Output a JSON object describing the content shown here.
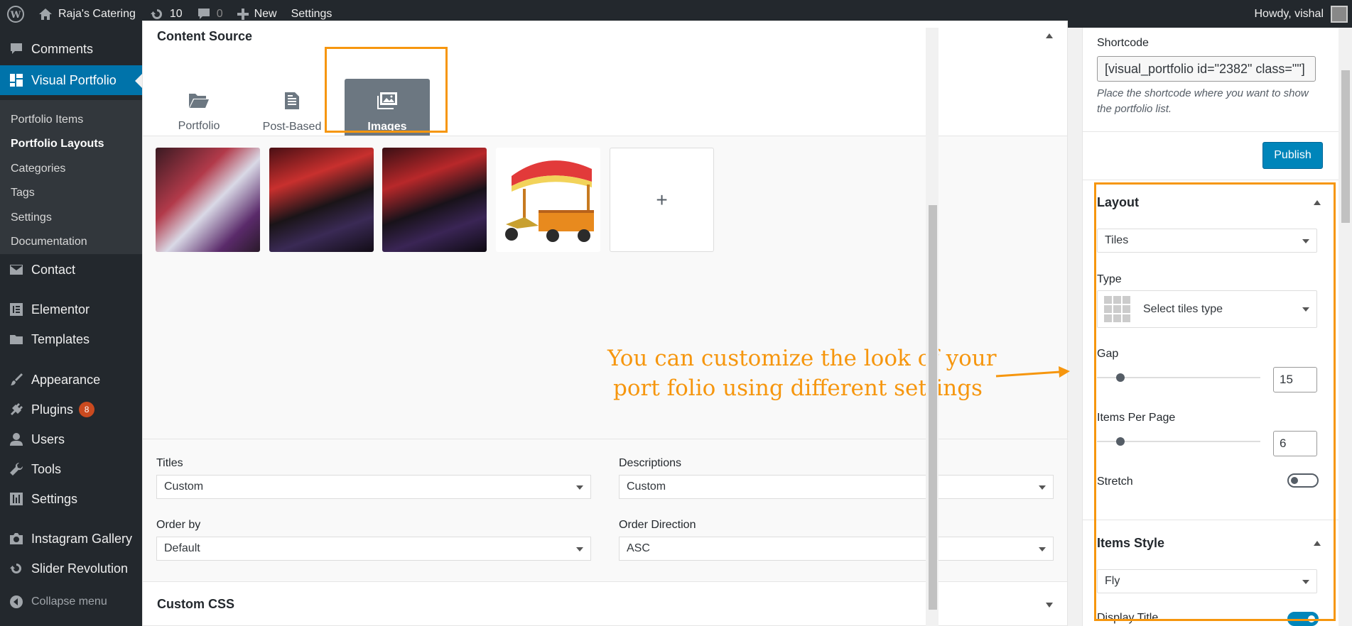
{
  "adminbar": {
    "site_name": "Raja's Catering",
    "updates_count": "10",
    "comments_count": "0",
    "new_label": "New",
    "settings_label": "Settings",
    "howdy": "Howdy, vishal"
  },
  "sidebar": {
    "comments": "Comments",
    "visual_portfolio": "Visual Portfolio",
    "sub": {
      "portfolio_items": "Portfolio Items",
      "portfolio_layouts": "Portfolio Layouts",
      "categories": "Categories",
      "tags": "Tags",
      "settings": "Settings",
      "documentation": "Documentation"
    },
    "contact": "Contact",
    "elementor": "Elementor",
    "templates": "Templates",
    "appearance": "Appearance",
    "plugins": "Plugins",
    "plugins_badge": "8",
    "users": "Users",
    "tools": "Tools",
    "settings": "Settings",
    "instagram": "Instagram Gallery",
    "slider": "Slider Revolution",
    "collapse": "Collapse menu"
  },
  "content": {
    "section_title": "Content Source",
    "tabs": {
      "portfolio": "Portfolio",
      "post_based": "Post-Based",
      "images": "Images"
    },
    "add_symbol": "+",
    "titles_label": "Titles",
    "titles_value": "Custom",
    "descriptions_label": "Descriptions",
    "descriptions_value": "Custom",
    "orderby_label": "Order by",
    "orderby_value": "Default",
    "orderdir_label": "Order Direction",
    "orderdir_value": "ASC",
    "custom_css": "Custom CSS"
  },
  "annotation": {
    "line1": "You can customize the look of your",
    "line2": "port folio using different settings"
  },
  "right": {
    "shortcode_label": "Shortcode",
    "shortcode_value": "[visual_portfolio id=\"2382\" class=\"\"]",
    "shortcode_help": "Place the shortcode where you want to show the portfolio list.",
    "publish": "Publish",
    "layout_title": "Layout",
    "layout_value": "Tiles",
    "type_label": "Type",
    "type_value": "Select tiles type",
    "gap_label": "Gap",
    "gap_value": "15",
    "items_per_page_label": "Items Per Page",
    "items_per_page_value": "6",
    "stretch_label": "Stretch",
    "stretch_on": false,
    "items_style_title": "Items Style",
    "items_style_value": "Fly",
    "display_title_label": "Display Title",
    "display_title_on": true
  },
  "colors": {
    "accent": "#0073aa",
    "annotation": "#f6960e",
    "publish": "#0085ba",
    "badge": "#ca4a1f"
  }
}
